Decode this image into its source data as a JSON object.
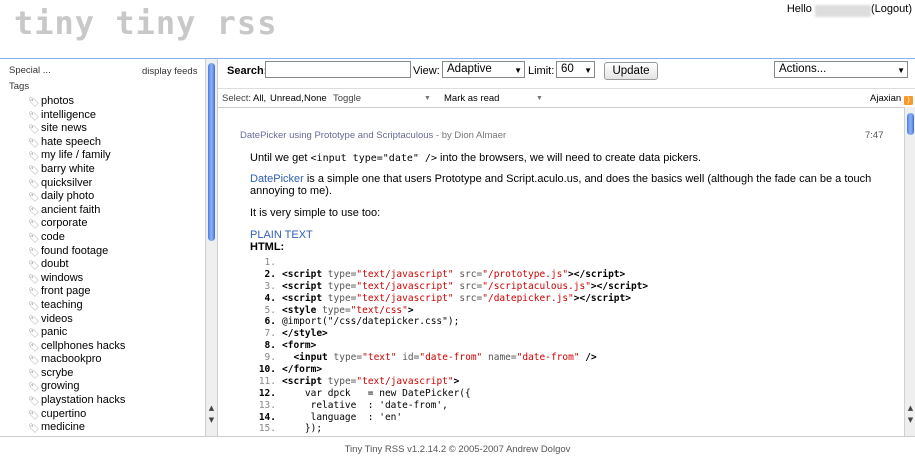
{
  "header": {
    "logo": "tiny tiny rss",
    "hello": "Hello",
    "username": "user",
    "logout": "Logout"
  },
  "sidebar": {
    "special": "Special ...",
    "display_feeds": "display feeds",
    "tags_label": "Tags",
    "tags": [
      "photos",
      "intelligence",
      "site news",
      "hate speech",
      "my life / family",
      "barry white",
      "quicksilver",
      "daily photo",
      "ancient faith",
      "corporate",
      "code",
      "found footage",
      "doubt",
      "windows",
      "front page",
      "teaching",
      "videos",
      "panic",
      "cellphones hacks",
      "macbookpro",
      "scrybe",
      "growing",
      "playstation hacks",
      "cupertino",
      "medicine"
    ]
  },
  "toolbar": {
    "search_label": "Search:",
    "search_value": "",
    "view_label": "View:",
    "view_value": "Adaptive",
    "limit_label": "Limit:",
    "limit_value": "60",
    "update_button": "Update",
    "actions_value": "Actions..."
  },
  "subbar": {
    "select_label": "Select:",
    "all": "All,",
    "unread": "Unread,",
    "none": "None",
    "toggle": "Toggle",
    "mark_as_read": "Mark as read",
    "feed_name": "Ajaxian",
    "rss_icon": "rss-icon"
  },
  "article": {
    "title": "DatePicker using Prototype and Scriptaculous",
    "byline": " - by Dion Almaer",
    "time": "7:47",
    "p1_a": "Until we get ",
    "p1_code": "<input type=\"date\" />",
    "p1_b": " into the browsers, we will need to create data pickers.",
    "p2_link": "DatePicker",
    "p2_rest": " is a simple one that users Prototype and Script.aculo.us, and does the basics well (although the fade can be a touch annoying to me).",
    "p3": "It is very simple to use too:",
    "plain_text": "PLAIN TEXT",
    "html_label": "HTML:"
  },
  "code": [
    {
      "n": "1.",
      "b": false,
      "html": ""
    },
    {
      "n": "2.",
      "b": true,
      "html": "<span class=\"kw\">&lt;script</span> <span class=\"at\">type=</span><span class=\"st\">\"text/javascript\"</span> <span class=\"at\">src=</span><span class=\"st\">\"/prototype.js\"</span><span class=\"kw\">&gt;&lt;/script&gt;</span>"
    },
    {
      "n": "3.",
      "b": false,
      "html": "<span class=\"kw\">&lt;script</span> <span class=\"at\">type=</span><span class=\"st\">\"text/javascript\"</span> <span class=\"at\">src=</span><span class=\"st\">\"/scriptaculous.js\"</span><span class=\"kw\">&gt;&lt;/script&gt;</span>"
    },
    {
      "n": "4.",
      "b": true,
      "html": "<span class=\"kw\">&lt;script</span> <span class=\"at\">type=</span><span class=\"st\">\"text/javascript\"</span> <span class=\"at\">src=</span><span class=\"st\">\"/datepicker.js\"</span><span class=\"kw\">&gt;&lt;/script&gt;</span>"
    },
    {
      "n": "5.",
      "b": false,
      "html": "<span class=\"kw\">&lt;style</span> <span class=\"at\">type=</span><span class=\"st\">\"text/css\"</span><span class=\"kw\">&gt;</span>"
    },
    {
      "n": "6.",
      "b": true,
      "html": "@import(\"/css/datepicker.css\");"
    },
    {
      "n": "7.",
      "b": false,
      "html": "<span class=\"kw\">&lt;/style&gt;</span>"
    },
    {
      "n": "8.",
      "b": true,
      "html": "<span class=\"kw\">&lt;form&gt;</span>"
    },
    {
      "n": "9.",
      "b": false,
      "html": "  <span class=\"kw\">&lt;input</span> <span class=\"at\">type=</span><span class=\"st\">\"text\"</span> <span class=\"at\">id=</span><span class=\"st\">\"date-from\"</span> <span class=\"at\">name=</span><span class=\"st\">\"date-from\"</span> <span class=\"kw\">/&gt;</span>"
    },
    {
      "n": "10.",
      "b": true,
      "html": "<span class=\"kw\">&lt;/form&gt;</span>"
    },
    {
      "n": "11.",
      "b": false,
      "html": "<span class=\"kw\">&lt;script</span> <span class=\"at\">type=</span><span class=\"st\">\"text/javascript\"</span><span class=\"kw\">&gt;</span>"
    },
    {
      "n": "12.",
      "b": true,
      "html": "    var dpck   = new DatePicker({"
    },
    {
      "n": "13.",
      "b": false,
      "html": "     relative  : 'date-from',"
    },
    {
      "n": "14.",
      "b": true,
      "html": "     language  : 'en'"
    },
    {
      "n": "15.",
      "b": false,
      "html": "    });"
    }
  ],
  "footer": "Tiny Tiny RSS v1.2.14.2 © 2005-2007 Andrew Dolgov"
}
